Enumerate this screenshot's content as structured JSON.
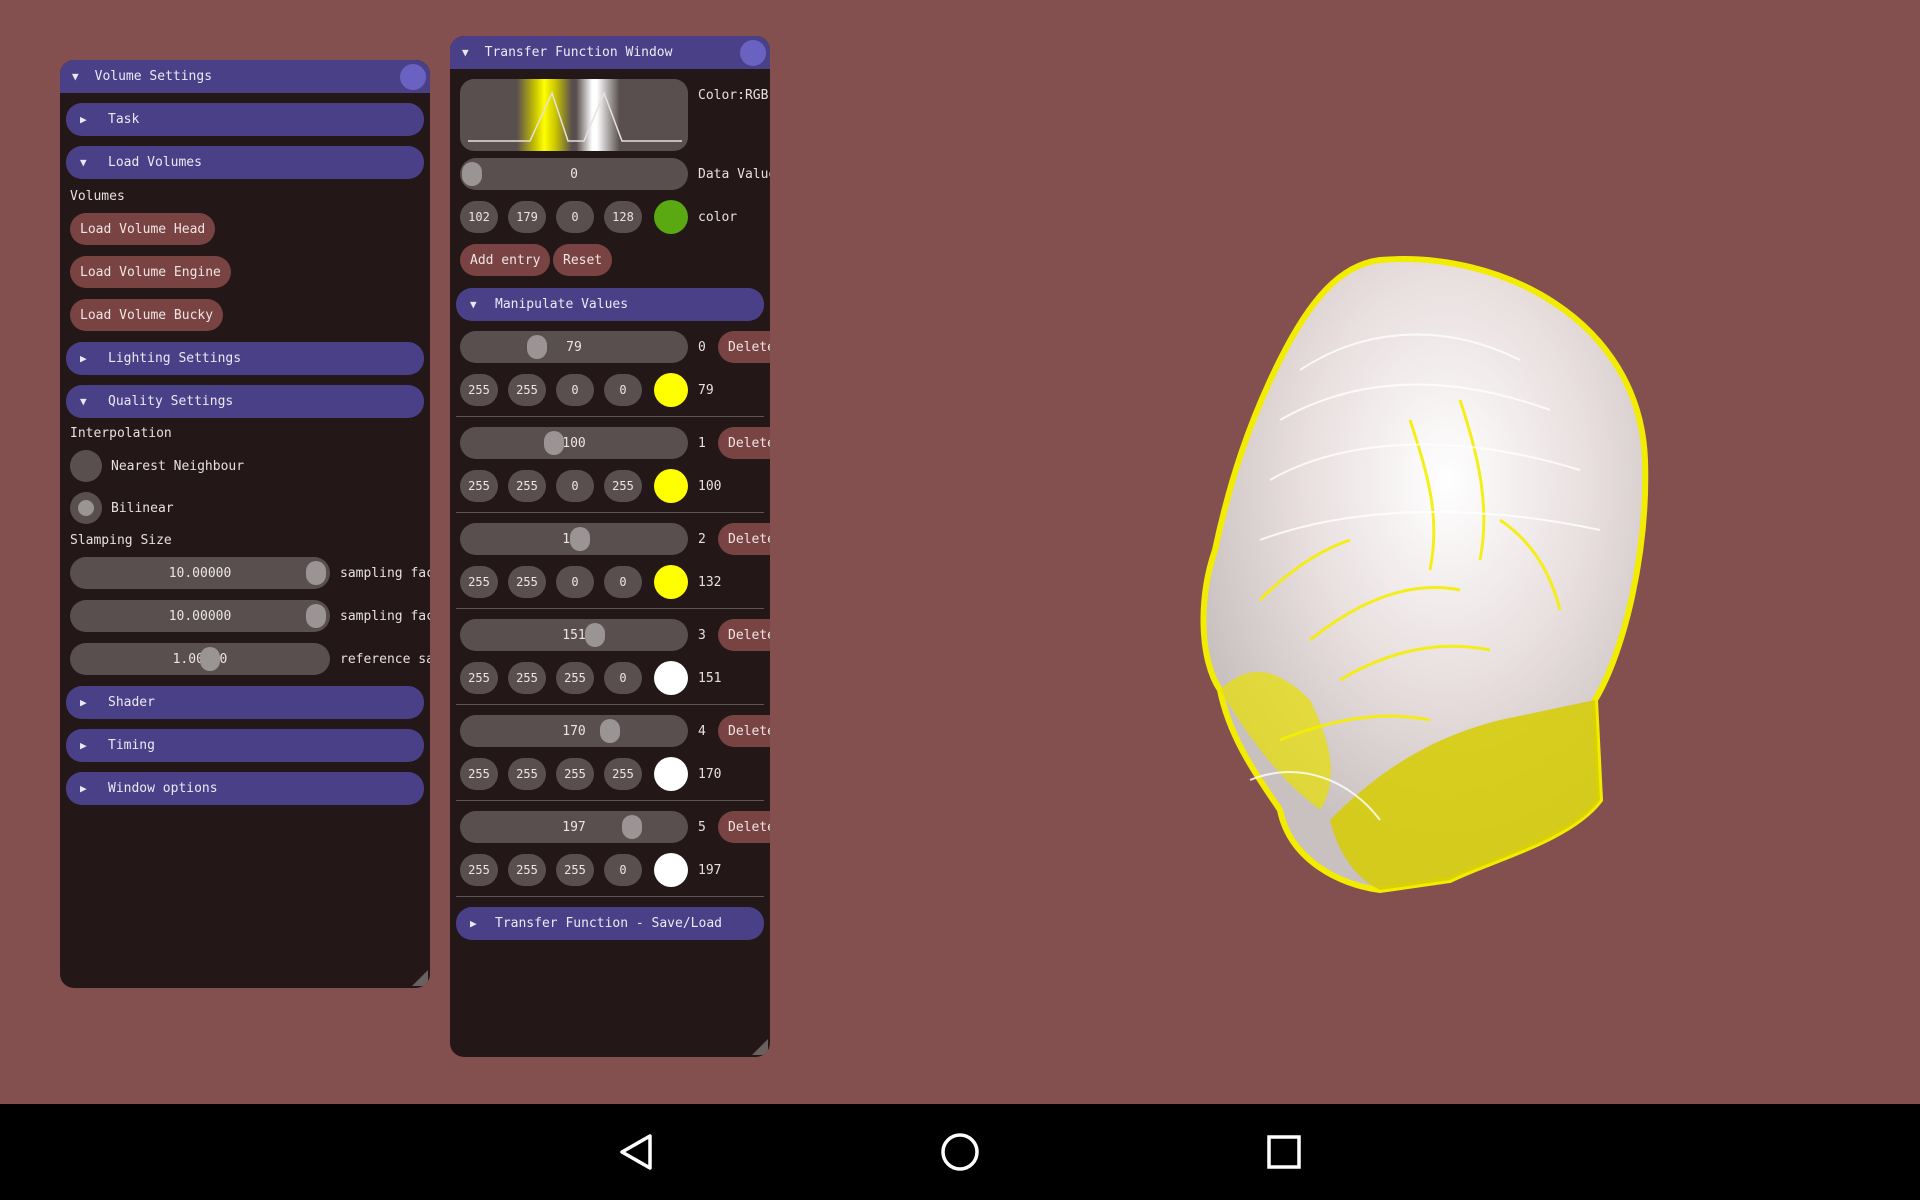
{
  "volume_window": {
    "title": "Volume Settings",
    "task": "Task",
    "load_volumes": "Load Volumes",
    "volumes_label": "Volumes",
    "load_buttons": [
      "Load Volume Head",
      "Load Volume Engine",
      "Load Volume Bucky"
    ],
    "lighting": "Lighting Settings",
    "quality": "Quality Settings",
    "interpolation": "Interpolation",
    "nearest": "Nearest Neighbour",
    "bilinear": "Bilinear",
    "sampling_label": "Slamping Size",
    "sliders": [
      {
        "value": "10.00000",
        "label": "sampling fac",
        "fraction": 1.0
      },
      {
        "value": "10.00000",
        "label": "sampling fac",
        "fraction": 1.0
      },
      {
        "value": "1.00000",
        "label": "reference sa",
        "fraction": 0.55
      }
    ],
    "shader": "Shader",
    "timing": "Timing",
    "window_options": "Window options"
  },
  "tf_window": {
    "title": "Transfer Function Window",
    "color_mode": "Color:RGB",
    "data_value": "0",
    "data_value_label": "Data Value",
    "color_values": [
      "102",
      "179",
      "0",
      "128"
    ],
    "color_label": "color",
    "color_swatch": "#5aa812",
    "add_entry": "Add entry",
    "reset": "Reset",
    "manipulate": "Manipulate Values",
    "delete_label": "Delete",
    "entries": [
      {
        "value": "79",
        "index": "0",
        "rgba": [
          "255",
          "255",
          "0",
          "0"
        ],
        "swatch": "#ffff00"
      },
      {
        "value": "100",
        "index": "1",
        "rgba": [
          "255",
          "255",
          "0",
          "255"
        ],
        "swatch": "#ffff00"
      },
      {
        "value": "132",
        "index": "2",
        "rgba": [
          "255",
          "255",
          "0",
          "0"
        ],
        "swatch": "#ffff00"
      },
      {
        "value": "151",
        "index": "3",
        "rgba": [
          "255",
          "255",
          "255",
          "0"
        ],
        "swatch": "#ffffff"
      },
      {
        "value": "170",
        "index": "4",
        "rgba": [
          "255",
          "255",
          "255",
          "255"
        ],
        "swatch": "#ffffff"
      },
      {
        "value": "197",
        "index": "5",
        "rgba": [
          "255",
          "255",
          "255",
          "0"
        ],
        "swatch": "#ffffff"
      }
    ],
    "save_load": "Transfer Function - Save/Load"
  },
  "icons": {
    "back": "back-triangle-icon",
    "home": "home-circle-icon",
    "recents": "recents-square-icon"
  }
}
